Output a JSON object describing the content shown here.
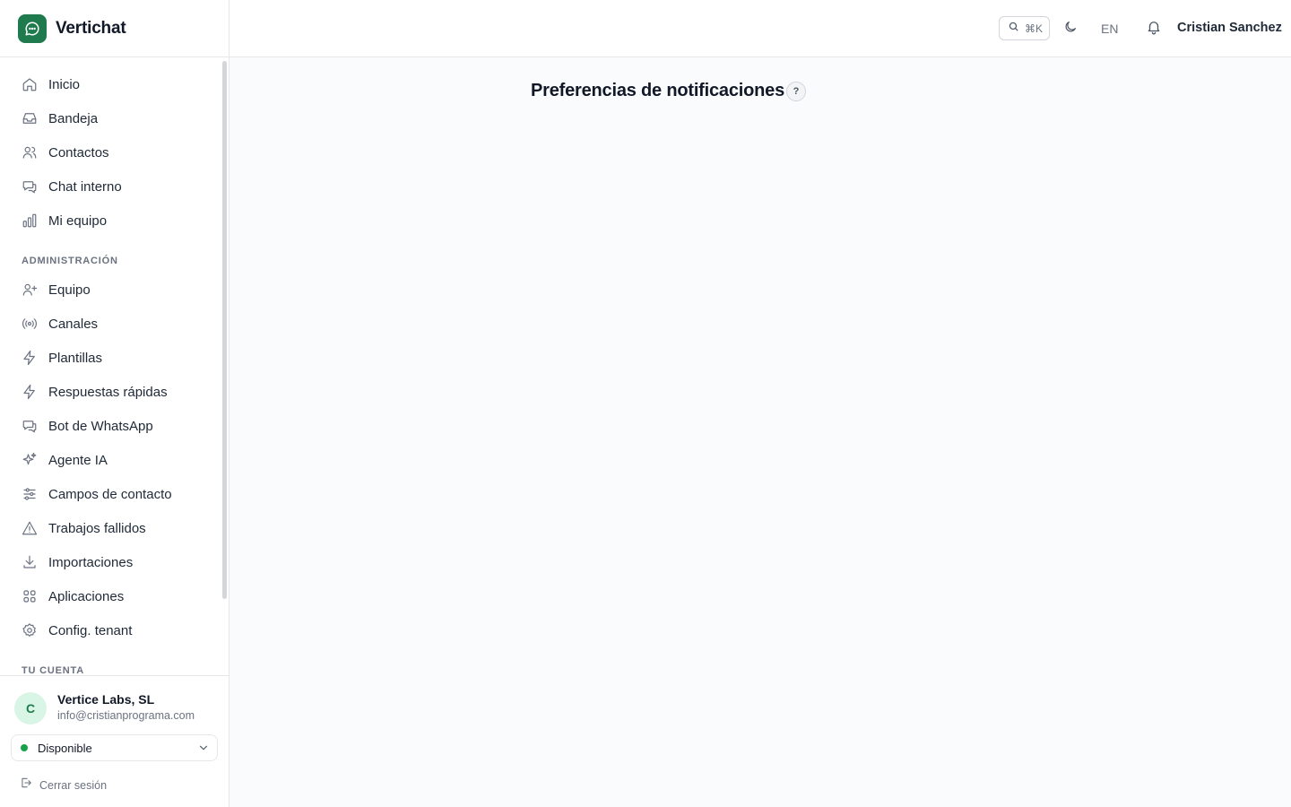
{
  "brand": {
    "name": "Vertichat"
  },
  "nav": {
    "main": [
      {
        "label": "Inicio",
        "icon": "home-icon"
      },
      {
        "label": "Bandeja",
        "icon": "inbox-icon"
      },
      {
        "label": "Contactos",
        "icon": "users-icon"
      },
      {
        "label": "Chat interno",
        "icon": "chat-icon"
      },
      {
        "label": "Mi equipo",
        "icon": "bar-chart-icon"
      }
    ],
    "admin_title": "ADMINISTRACIÓN",
    "admin": [
      {
        "label": "Equipo",
        "icon": "user-plus-icon"
      },
      {
        "label": "Canales",
        "icon": "radio-icon"
      },
      {
        "label": "Plantillas",
        "icon": "zap-icon"
      },
      {
        "label": "Respuestas rápidas",
        "icon": "zap-icon"
      },
      {
        "label": "Bot de WhatsApp",
        "icon": "chat-icon"
      },
      {
        "label": "Agente IA",
        "icon": "sparkles-icon"
      },
      {
        "label": "Campos de contacto",
        "icon": "sliders-icon"
      },
      {
        "label": "Trabajos fallidos",
        "icon": "warning-icon"
      },
      {
        "label": "Importaciones",
        "icon": "download-icon"
      },
      {
        "label": "Aplicaciones",
        "icon": "grid-icon"
      },
      {
        "label": "Config. tenant",
        "icon": "gear-icon"
      }
    ],
    "account_title": "TU CUENTA"
  },
  "account": {
    "avatar_initial": "C",
    "org_name": "Vertice Labs, SL",
    "email": "info@cristianprograma.com",
    "status": "Disponible",
    "status_color": "#16a34a",
    "logout_label": "Cerrar sesión"
  },
  "topbar": {
    "search_shortcut": "⌘K",
    "language": "EN",
    "user_name": "Cristian Sanchez"
  },
  "main": {
    "title": "Preferencias de notificaciones",
    "help": "?"
  },
  "colors": {
    "brand": "#1f7a4d",
    "status_available": "#16a34a"
  }
}
